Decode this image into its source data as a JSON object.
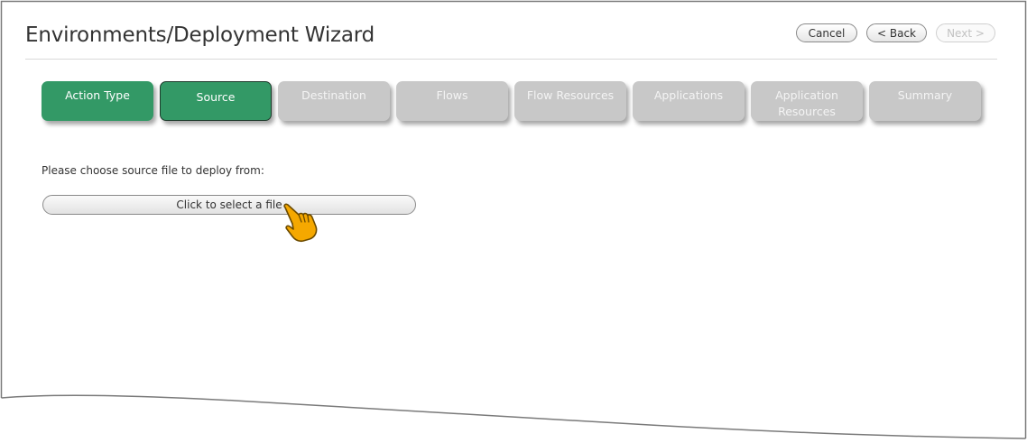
{
  "header": {
    "title": "Environments/Deployment Wizard",
    "cancel_label": "Cancel",
    "back_label": "< Back",
    "next_label": "Next >"
  },
  "steps": [
    {
      "label": "Action Type",
      "state": "done"
    },
    {
      "label": "Source",
      "state": "current"
    },
    {
      "label": "Destination",
      "state": "pending"
    },
    {
      "label": "Flows",
      "state": "pending"
    },
    {
      "label": "Flow Resources",
      "state": "pending"
    },
    {
      "label": "Applications",
      "state": "pending"
    },
    {
      "label": "Application\nResources",
      "state": "pending"
    },
    {
      "label": "Summary",
      "state": "pending"
    }
  ],
  "content": {
    "prompt": "Please choose source file to deploy from:",
    "select_file_label": "Click to select a file"
  },
  "colors": {
    "step_active": "#339966",
    "step_pending": "#c8c8c8",
    "cursor_hand": "#f5a800"
  },
  "icons": {
    "cursor": "pointing-hand-cursor-icon"
  }
}
